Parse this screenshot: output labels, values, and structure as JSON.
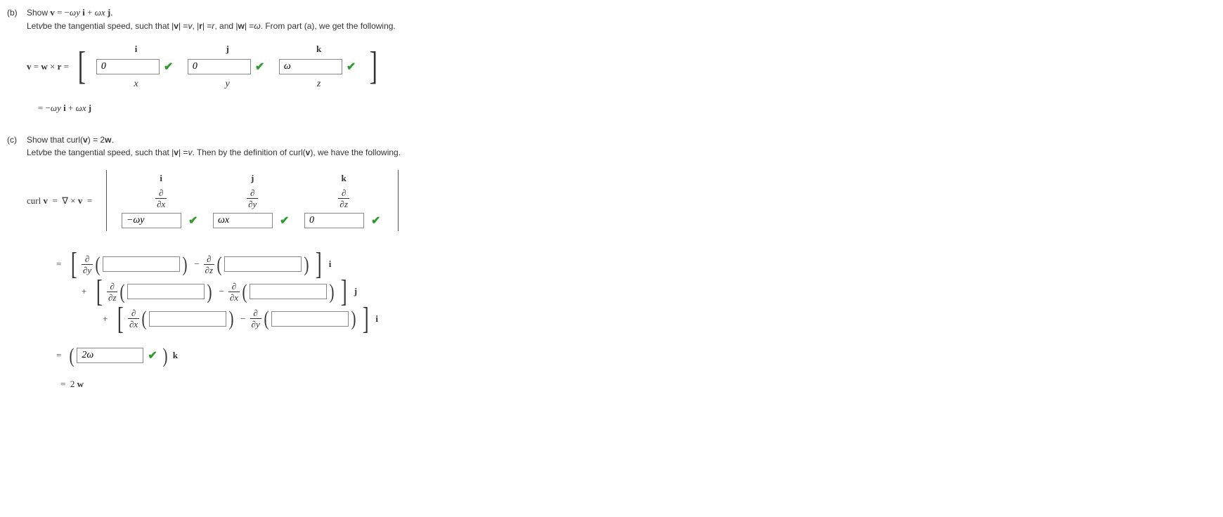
{
  "partB": {
    "label": "(b)",
    "title_pre": "Show ",
    "title_eq": "v = −ωy i + ωx j.",
    "intro_pre": "Let ",
    "intro_v": "v",
    "intro_mid": " be the tangential speed, such that |",
    "intro_v2": "v",
    "intro_mid2": "| = ",
    "intro_v3": "v",
    "intro_mid3": ", |",
    "intro_r": "r",
    "intro_mid4": "| = ",
    "intro_r2": "r",
    "intro_mid5": ", and |",
    "intro_w": "w",
    "intro_mid6": "| = ",
    "intro_omega": "ω",
    "intro_end": ". From part (a), we get the following.",
    "lhs": "v = w × r =",
    "hdr_i": "i",
    "hdr_j": "j",
    "hdr_k": "k",
    "val_i": "0",
    "val_j": "0",
    "val_k": "ω",
    "row3_i": "x",
    "row3_j": "y",
    "row3_k": "z",
    "result": "= −ωy i + ωx j"
  },
  "partC": {
    "label": "(c)",
    "title": "Show that curl(v) = 2w.",
    "intro_pre": "Let ",
    "intro_v": "v",
    "intro_mid": " be the tangential speed, such that |",
    "intro_v2": "v",
    "intro_mid2": "| = ",
    "intro_v3": "v",
    "intro_end": ". Then by the definition of curl(v), we have the following.",
    "lhs": "curl v  =  ∇ × v  =",
    "hdr_i": "i",
    "hdr_j": "j",
    "hdr_k": "k",
    "d": "∂",
    "dx": "∂x",
    "dy": "∂y",
    "dz": "∂z",
    "val_i": "−ωy",
    "val_j": "ωx",
    "val_k": "0",
    "exp1_d1": "∂",
    "exp1_den1": "∂y",
    "exp1_d2": "∂",
    "exp1_den2": "∂z",
    "exp1_unit": "i",
    "exp2_d1": "∂",
    "exp2_den1": "∂z",
    "exp2_d2": "∂",
    "exp2_den2": "∂x",
    "exp2_unit": "j",
    "exp3_d1": "∂",
    "exp3_den1": "∂x",
    "exp3_d2": "∂",
    "exp3_den2": "∂y",
    "exp3_unit": "i",
    "final_val": "2ω",
    "final_unit": "k",
    "result": "=  2 w"
  },
  "sym": {
    "eq": "=",
    "plus": "+",
    "minus_sign": "−"
  }
}
